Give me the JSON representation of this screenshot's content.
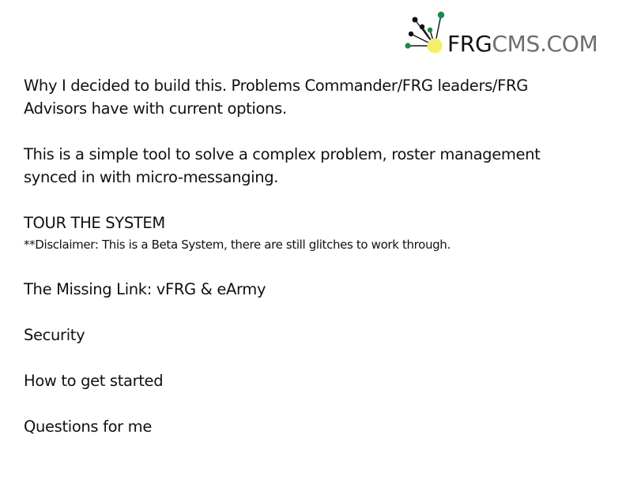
{
  "logo": {
    "text_strong": "FRG",
    "text_light": "CMS.COM",
    "icon": "network-dots-icon",
    "colors": {
      "green": "#1a8a4a",
      "yellow": "#f3ef6a",
      "black": "#111111",
      "gray": "#6e6e6e"
    }
  },
  "sections": {
    "why": {
      "line1": "Why I decided to build this.  Problems Commander/FRG leaders/FRG",
      "line2": "Advisors have with current options."
    },
    "simple_tool": {
      "line1": "This is a simple tool to solve a complex problem, roster management",
      "line2": "synced in with micro-messanging."
    },
    "tour": {
      "title": "TOUR THE SYSTEM",
      "disclaimer": "**Disclaimer: This is a Beta System, there are still glitches to work through."
    },
    "missing_link": "The Missing Link: vFRG & eArmy",
    "security": "Security",
    "get_started": "How to get started",
    "questions": "Questions for me"
  }
}
